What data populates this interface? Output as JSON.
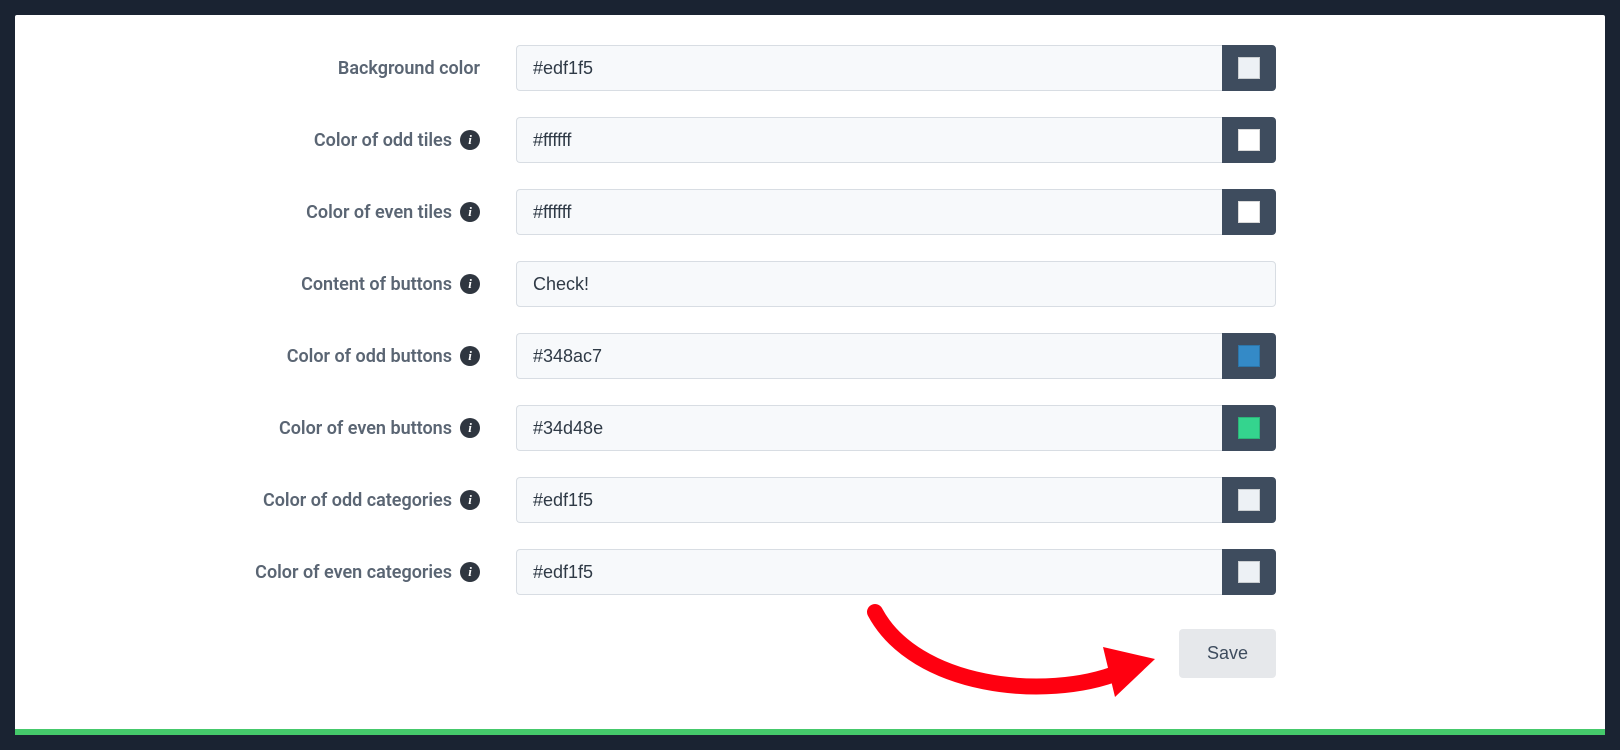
{
  "fields": {
    "background_color": {
      "label": "Background color",
      "value": "#edf1f5",
      "has_info": false,
      "has_swatch": true,
      "swatch": "#edf1f5"
    },
    "odd_tiles_color": {
      "label": "Color of odd tiles",
      "value": "#ffffff",
      "has_info": true,
      "has_swatch": true,
      "swatch": "#ffffff"
    },
    "even_tiles_color": {
      "label": "Color of even tiles",
      "value": "#ffffff",
      "has_info": true,
      "has_swatch": true,
      "swatch": "#ffffff"
    },
    "buttons_content": {
      "label": "Content of buttons",
      "value": "Check!",
      "has_info": true,
      "has_swatch": false,
      "swatch": ""
    },
    "odd_buttons_color": {
      "label": "Color of odd buttons",
      "value": "#348ac7",
      "has_info": true,
      "has_swatch": true,
      "swatch": "#348ac7"
    },
    "even_buttons_color": {
      "label": "Color of even buttons",
      "value": "#34d48e",
      "has_info": true,
      "has_swatch": true,
      "swatch": "#34d48e"
    },
    "odd_cats_color": {
      "label": "Color of odd categories",
      "value": "#edf1f5",
      "has_info": true,
      "has_swatch": true,
      "swatch": "#edf1f5"
    },
    "even_cats_color": {
      "label": "Color of even categories",
      "value": "#edf1f5",
      "has_info": true,
      "has_swatch": true,
      "swatch": "#edf1f5"
    }
  },
  "actions": {
    "save_label": "Save"
  }
}
